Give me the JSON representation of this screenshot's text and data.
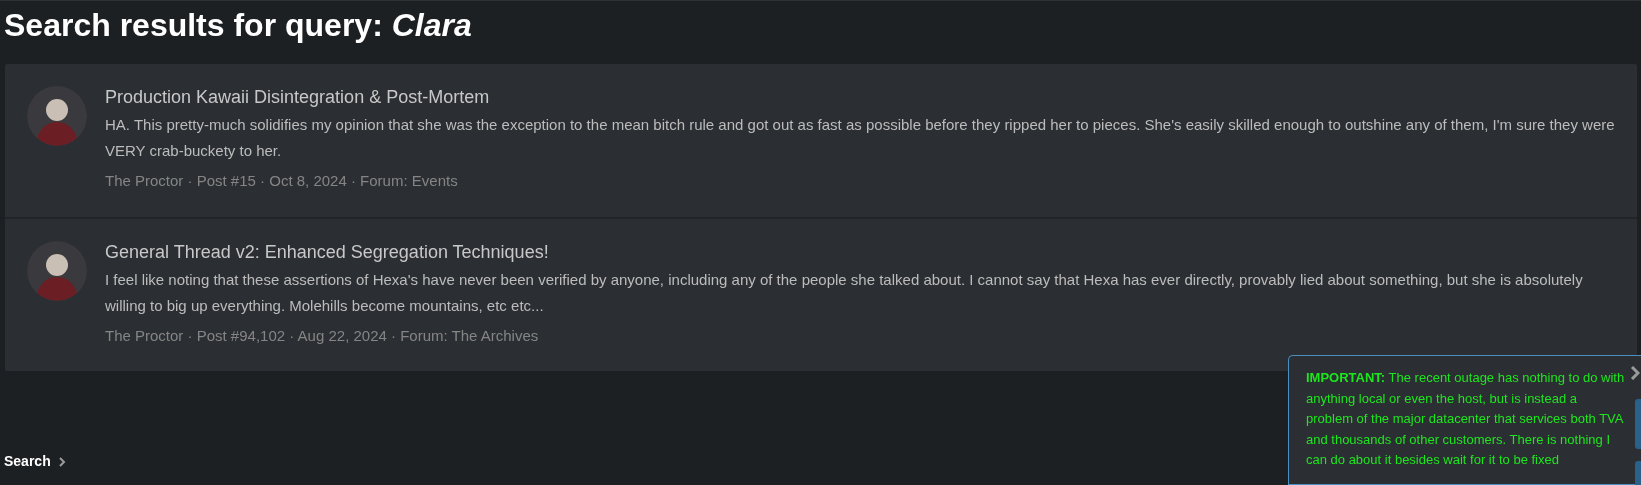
{
  "page_title": "Search results for query: *Clara*",
  "results": [
    {
      "title": "Production Kawaii Disintegration & Post-Mortem",
      "snippet": "HA. This pretty-much solidifies my opinion that she was the exception to the mean bitch rule and got out as fast as possible before they ripped her to pieces. She's easily skilled enough to outshine any of them, I'm sure they were VERY crab-buckety to her.",
      "meta": "The Proctor · Post #15 · Oct 8, 2024 · Forum: Events"
    },
    {
      "title": "General Thread v2: Enhanced Segregation Techniques!",
      "snippet": "I feel like noting that these assertions of Hexa's have never been verified by anyone, including any of the people she talked about. I cannot say that Hexa has ever directly, provably lied about something, but she is absolutely willing to big up everything. Molehills become mountains, etc etc...",
      "meta": "The Proctor · Post #94,102 · Aug 22, 2024 · Forum: The Archives"
    }
  ],
  "breadcrumb": [
    "Search"
  ],
  "notice": {
    "text": "**IMPORTANT:** The recent outage has nothing to do with anything local or even the host, but is instead a problem of the major datacenter that services both TVA and thousands of other customers. There is nothing I can do about it besides wait for it to be fixed"
  }
}
